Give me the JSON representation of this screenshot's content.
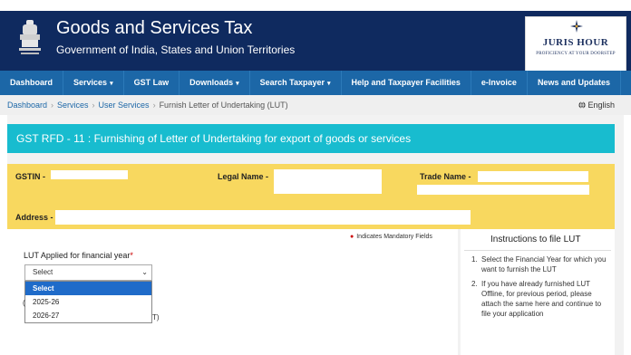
{
  "header": {
    "title": "Goods and Services Tax",
    "subtitle": "Government of India, States and Union Territories",
    "logo_name": "JURIS HOUR",
    "logo_tagline": "PROFICIENCY AT YOUR DOORSTEP"
  },
  "nav": {
    "items": [
      {
        "label": "Dashboard",
        "has_caret": false
      },
      {
        "label": "Services",
        "has_caret": true
      },
      {
        "label": "GST Law",
        "has_caret": false
      },
      {
        "label": "Downloads",
        "has_caret": true
      },
      {
        "label": "Search Taxpayer",
        "has_caret": true
      },
      {
        "label": "Help and Taxpayer Facilities",
        "has_caret": false
      },
      {
        "label": "e-Invoice",
        "has_caret": false
      },
      {
        "label": "News and Updates",
        "has_caret": false
      }
    ],
    "caret_glyph": "▾"
  },
  "breadcrumb": {
    "items": [
      "Dashboard",
      "Services",
      "User Services"
    ],
    "current": "Furnish Letter of Undertaking (LUT)",
    "separator": "›",
    "language": "English",
    "language_icon": "globe-icon"
  },
  "banner": {
    "title": "GST RFD - 11 : Furnishing of Letter of Undertaking for export of goods or services"
  },
  "taxpayer": {
    "gstin_label": "GSTIN -",
    "legal_name_label": "Legal Name -",
    "trade_name_label": "Trade Name -",
    "address_label": "Address -"
  },
  "form": {
    "mandatory_text": "Indicates Mandatory Fields",
    "lut_label": "LUT Applied for financial year",
    "select_value": "Select",
    "options": [
      "Select",
      "2025-26",
      "2026-27"
    ],
    "partial_c": "(",
    "partial_tail": "T)"
  },
  "instructions": {
    "title": "Instructions to file LUT",
    "items": [
      "Select the Financial Year for which you want to furnish the LUT",
      "If you have already furnished LUT Offline, for previous period, please attach the same here and continue to file your application"
    ]
  },
  "colors": {
    "header_bg": "#0f2a5f",
    "nav_bg": "#1c67a7",
    "banner_bg": "#18bccf",
    "info_bg": "#f8d85f",
    "selected_option": "#1f6bc9"
  }
}
